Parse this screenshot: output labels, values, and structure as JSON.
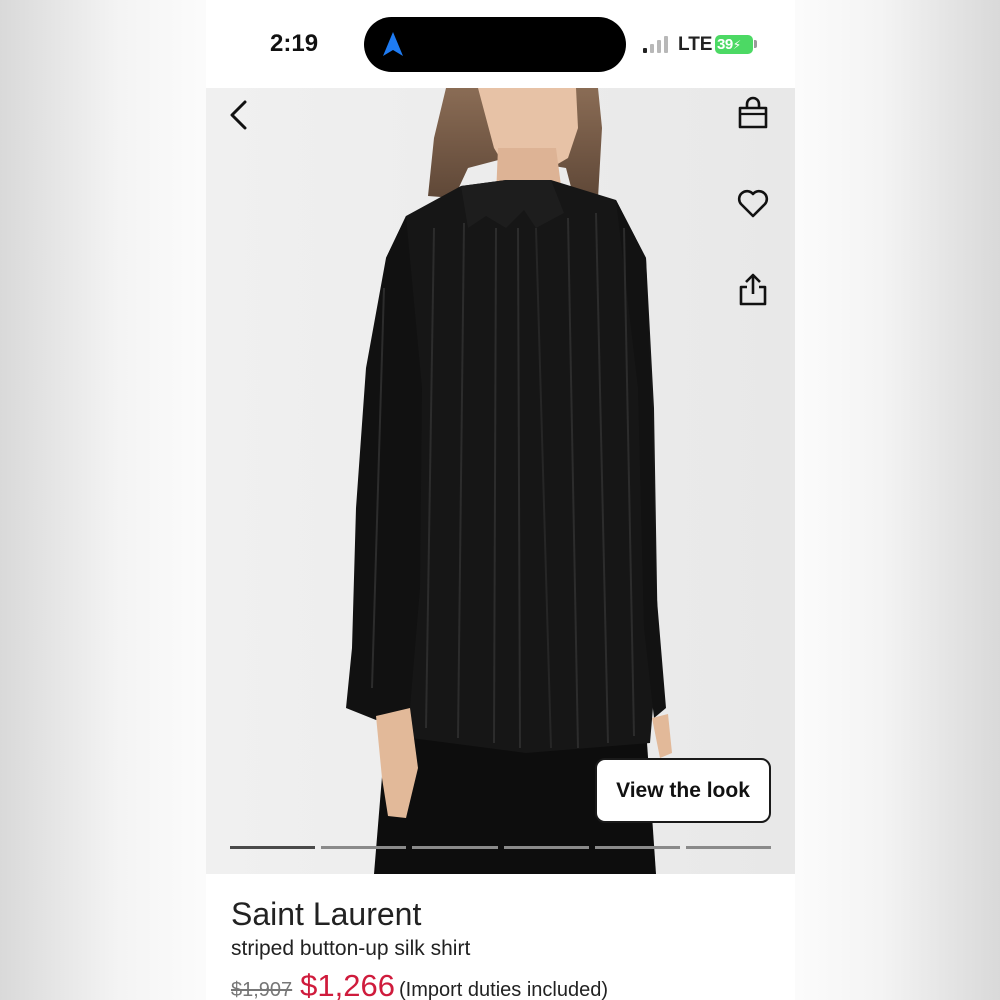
{
  "status_bar": {
    "time": "2:19",
    "network": "LTE",
    "battery": "39",
    "navigation_icon": "location-arrow-icon"
  },
  "toolbar": {
    "back_icon": "chevron-left-icon",
    "bag_icon": "shopping-bag-icon",
    "wishlist_icon": "heart-icon",
    "share_icon": "share-icon"
  },
  "hero": {
    "view_look_label": "View the look",
    "carousel_segments": 6,
    "active_segment": 0
  },
  "product": {
    "brand": "Saint Laurent",
    "name": "striped button-up silk shirt",
    "original_price": "$1,907",
    "sale_price": "$1,266",
    "price_note": "(Import duties included)"
  },
  "colors": {
    "sale_price": "#cf1b3c",
    "battery": "#4cd964",
    "nav_arrow": "#1e7bf2"
  }
}
